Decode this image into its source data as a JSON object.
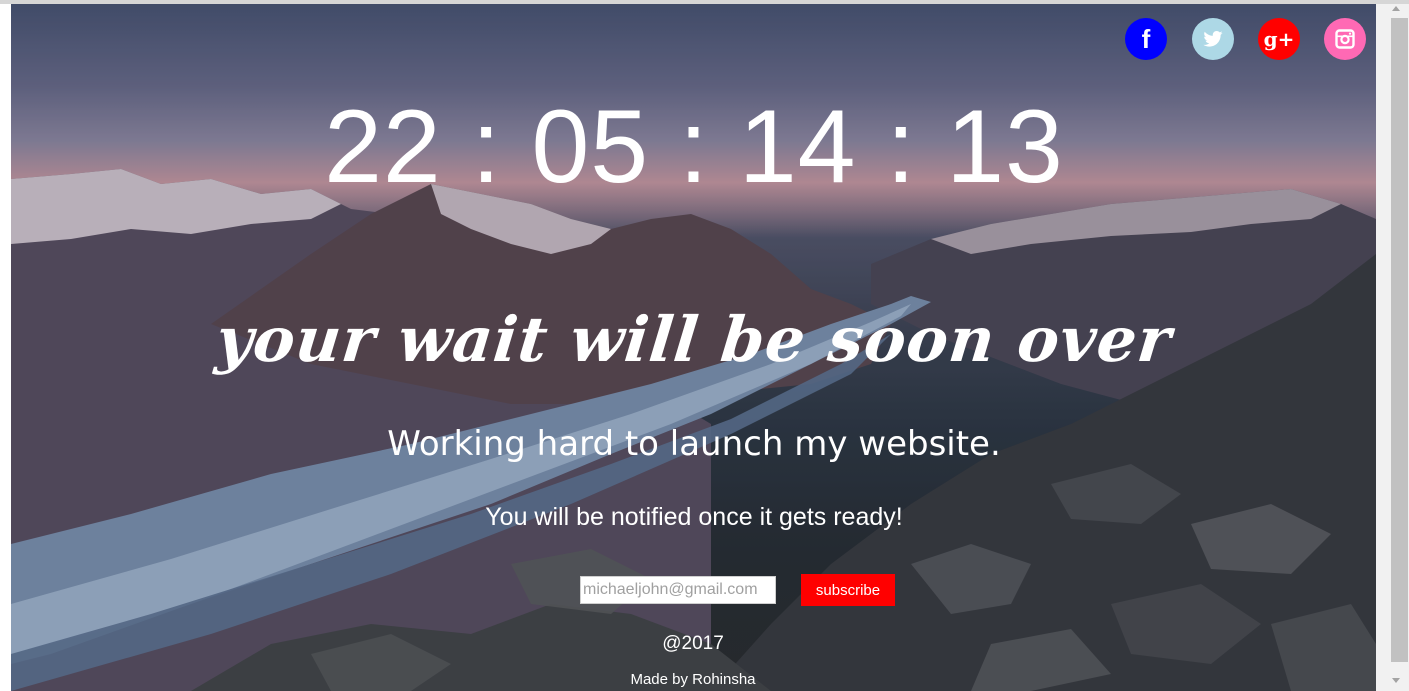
{
  "social": {
    "facebook_glyph": "f",
    "google_plus_glyph": "g+",
    "icons": [
      "facebook-icon",
      "twitter-icon",
      "google-plus-icon",
      "instagram-icon"
    ],
    "colors": {
      "facebook": "#0000ff",
      "twitter": "#add8e6",
      "google_plus": "#ff0000",
      "instagram": "#ff69b4"
    }
  },
  "countdown": {
    "days": "22",
    "hours": "05",
    "minutes": "14",
    "seconds": "13",
    "separator": " : "
  },
  "hero": {
    "tagline": "your wait will be soon over",
    "subtitle": "Working hard to launch my website.",
    "notice": "You will be notified once it gets ready!"
  },
  "subscribe_form": {
    "email_placeholder": "michaeljohn@gmail.com",
    "button_label": "subscribe",
    "button_color": "#ff0000"
  },
  "footer": {
    "year": "@2017",
    "credit": "Made by Rohinsha"
  }
}
